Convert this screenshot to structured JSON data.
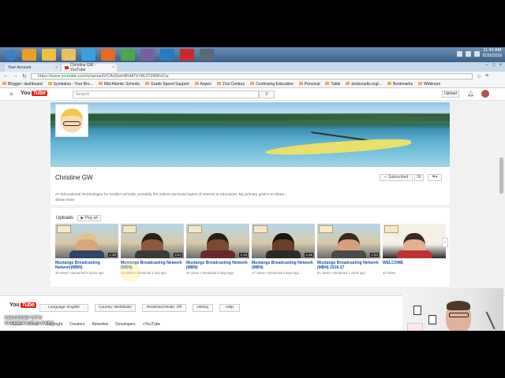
{
  "taskbar": {
    "icons": [
      {
        "name": "start-orb-icon",
        "color": "#3a7fc1"
      },
      {
        "name": "outlook-icon",
        "color": "#e8a020"
      },
      {
        "name": "pin-icon",
        "color": "#f0c040"
      },
      {
        "name": "folder-icon",
        "color": "#e8c060"
      },
      {
        "name": "ie-icon",
        "color": "#3aa0e0"
      },
      {
        "name": "firefox-icon",
        "color": "#e86a20"
      },
      {
        "name": "chrome-icon",
        "color": "#4aa84a"
      },
      {
        "name": "person-icon",
        "color": "#7a5ea0"
      },
      {
        "name": "lync-icon",
        "color": "#2a7ac0"
      },
      {
        "name": "pdf-icon",
        "color": "#cc2a2a"
      },
      {
        "name": "monitor-icon",
        "color": "#5a6a7a"
      }
    ],
    "clock_time": "11:43 AM",
    "clock_date": "8/28/2016"
  },
  "browser": {
    "tabs": [
      {
        "label": "Your Account",
        "active": false
      },
      {
        "label": "Christine GW - YouTube",
        "active": true
      }
    ],
    "url_secure": "https://www.youtube.com/",
    "url_rest": "channel/UCA43wmBIdATkYAUTi3NWvCw",
    "bookmarks": [
      "Blogger: dashboard",
      "Symbaloo - Your Bro...",
      "Mid-Atlantic Schools",
      "Grade Speed Support",
      "Aspen",
      "21st Century",
      "Continuing Education",
      "Personal",
      "Table",
      "dodsvradio.org/...",
      "Bookmarks",
      "Webinars"
    ]
  },
  "youtube": {
    "logo_you": "You",
    "logo_tube": "Tube",
    "search_placeholder": "Search",
    "upload_label": "Upload",
    "channel_name": "Christine GW",
    "subscribed_label": "Subscribed",
    "subscriber_count": "58",
    "description": "An Educational Technologist for DoDEA schools; primarily the videos surround topics of interest to educators. My primary goal is to share...",
    "show_more": "Show more",
    "uploads_title": "Uploads",
    "play_all": "Play all",
    "videos": [
      {
        "title": "Mustangs Broadcasting Network(MBN)",
        "views": "29 views",
        "age": "Streamed 5 hours ago",
        "duration": "4:38",
        "shirt": "#2f4468",
        "skin": "#d9a57a",
        "hair": "#e2c58a"
      },
      {
        "title": "Mustangs Broadcasting Network (MBN)",
        "views": "32 views",
        "age": "Streamed 1 day ago",
        "duration": "4:54",
        "shirt": "#3a3a3a",
        "skin": "#8a5a3c",
        "hair": "#2a1e16"
      },
      {
        "title": "Mustangs Broadcasting Network (MBN)",
        "views": "26 views",
        "age": "Streamed 5 days ago",
        "duration": "4:18",
        "shirt": "#6a2a2a",
        "skin": "#7a4a30",
        "hair": "#2a1e16"
      },
      {
        "title": "Mustangs Broadcasting Network (MBN)",
        "views": "47 views",
        "age": "Streamed 6 days ago",
        "duration": "4:38",
        "shirt": "#2a2a2a",
        "skin": "#6a4028",
        "hair": "#1a1410"
      },
      {
        "title": "Mustangs Broadcasting Network (MBN) 2016-17",
        "views": "51 views",
        "age": "Streamed 1 week ago",
        "duration": "4:54",
        "shirt": "#4a4a4a",
        "skin": "#d6a07a",
        "hair": "#3a2a20"
      },
      {
        "title": "WELCOME",
        "views": "43 views",
        "age": "",
        "duration": "",
        "shirt": "#c03030",
        "skin": "#e0b090",
        "hair": "#3a2a20"
      }
    ],
    "footer": {
      "language_label": "Language: English",
      "country_label": "Country: Worldwide",
      "restricted_label": "Restricted Mode: Off",
      "history_label": "History",
      "help_label": "Help",
      "links": [
        "About",
        "Press",
        "Copyright",
        "Creators",
        "Advertise",
        "Developers",
        "+YouTube"
      ]
    }
  },
  "watermark": {
    "line1": "RECORDED WITH",
    "line2": "SCREENCAST-O-MATIC"
  }
}
